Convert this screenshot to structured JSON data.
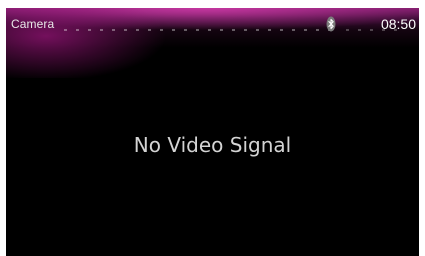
{
  "status_bar": {
    "title": "Camera",
    "bluetooth_icon": "bluetooth-icon",
    "time": "08:50"
  },
  "main": {
    "message": "No Video Signal"
  },
  "colors": {
    "background": "#000000",
    "accent_glow": "#b0268f",
    "text": "#e0e0e0"
  }
}
